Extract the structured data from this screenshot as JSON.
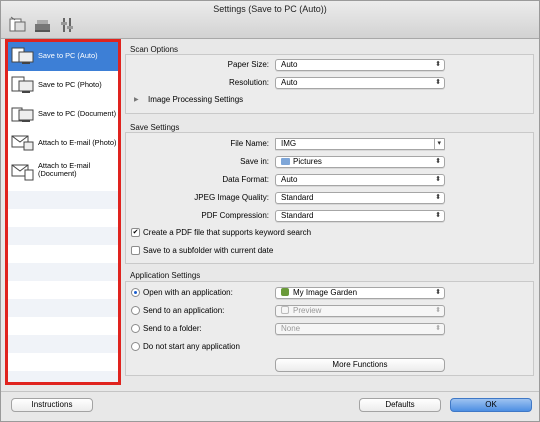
{
  "window": {
    "title": "Settings (Save to PC (Auto))"
  },
  "toolbar": {
    "icons": [
      "scan-to-pc-icon",
      "scanner-icon",
      "general-settings-icon"
    ]
  },
  "sidebar": {
    "items": [
      {
        "label": "Save to PC (Auto)",
        "icon": "save-pc-auto-icon",
        "selected": true
      },
      {
        "label": "Save to PC (Photo)",
        "icon": "save-pc-photo-icon"
      },
      {
        "label": "Save to PC (Document)",
        "icon": "save-pc-document-icon"
      },
      {
        "label": "Attach to E-mail (Photo)",
        "icon": "email-photo-icon"
      },
      {
        "label_line1": "Attach to E-mail",
        "label_line2": "(Document)",
        "icon": "email-document-icon"
      }
    ]
  },
  "scan_options": {
    "heading": "Scan Options",
    "paper_size_label": "Paper Size:",
    "paper_size_value": "Auto",
    "resolution_label": "Resolution:",
    "resolution_value": "Auto",
    "image_processing": "Image Processing Settings"
  },
  "save_settings": {
    "heading": "Save Settings",
    "file_name_label": "File Name:",
    "file_name_value": "IMG",
    "save_in_label": "Save in:",
    "save_in_value": "Pictures",
    "data_format_label": "Data Format:",
    "data_format_value": "Auto",
    "jpeg_quality_label": "JPEG Image Quality:",
    "jpeg_quality_value": "Standard",
    "pdf_compression_label": "PDF Compression:",
    "pdf_compression_value": "Standard",
    "keyword_search_label": "Create a PDF file that supports keyword search",
    "keyword_search_checked": true,
    "subfolder_label": "Save to a subfolder with current date",
    "subfolder_checked": false
  },
  "application_settings": {
    "heading": "Application Settings",
    "open_with_label": "Open with an application:",
    "open_with_value": "My Image Garden",
    "send_to_app_label": "Send to an application:",
    "send_to_app_value": "Preview",
    "send_to_folder_label": "Send to a folder:",
    "send_to_folder_value": "None",
    "do_not_start_label": "Do not start any application",
    "more_functions": "More Functions",
    "selected_option": "open_with"
  },
  "footer": {
    "instructions": "Instructions",
    "defaults": "Defaults",
    "ok": "OK"
  },
  "colors": {
    "selection": "#3d7fd6",
    "highlight_border": "#e0231e",
    "ok_button": "#4d8fe3"
  }
}
